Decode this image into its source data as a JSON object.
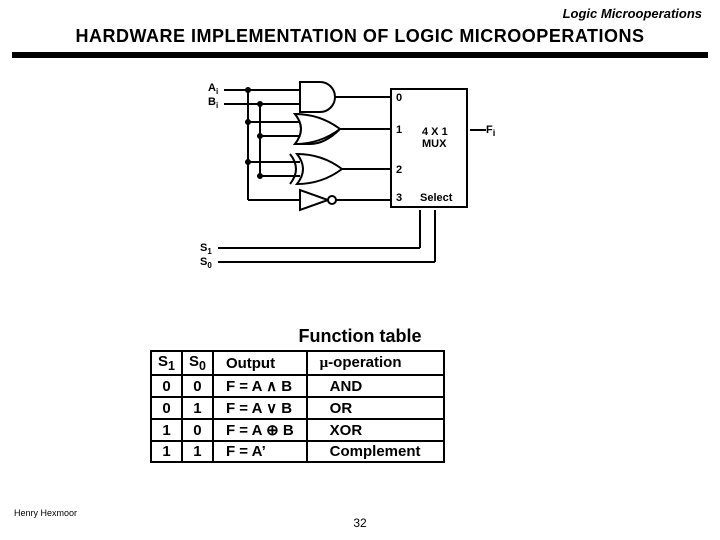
{
  "header": {
    "section": "Logic Microoperations"
  },
  "title": "HARDWARE  IMPLEMENTATION  OF  LOGIC MICROOPERATIONS",
  "diagram": {
    "inputs": {
      "A": "A",
      "Ai_sub": "i",
      "B": "B",
      "Bi_sub": "i"
    },
    "mux": {
      "in0": "0",
      "in1": "1",
      "in2": "2",
      "in3": "3",
      "label_top": "4 X 1",
      "label_bot": "MUX",
      "select": "Select"
    },
    "output": {
      "F": "F",
      "Fi_sub": "i"
    },
    "select_lines": {
      "S1": "S",
      "S1_sub": "1",
      "S0": "S",
      "S0_sub": "0"
    }
  },
  "function_table": {
    "title": "Function table",
    "headers": {
      "s1": "S",
      "s1_sub": "1",
      "s0": "S",
      "s0_sub": "0",
      "output": "Output",
      "op": "-operation",
      "mu": "μ"
    },
    "rows": [
      {
        "s1": "0",
        "s0": "0",
        "output": "F = A ∧ B",
        "op": "AND"
      },
      {
        "s1": "0",
        "s0": "1",
        "output": "F = A ∨ B",
        "op": "OR"
      },
      {
        "s1": "1",
        "s0": "0",
        "output": "F = A ⊕ B",
        "op": "XOR"
      },
      {
        "s1": "1",
        "s0": "1",
        "output": "F = A’",
        "op": "Complement"
      }
    ]
  },
  "footer": {
    "author": "Henry Hexmoor",
    "page": "32"
  }
}
